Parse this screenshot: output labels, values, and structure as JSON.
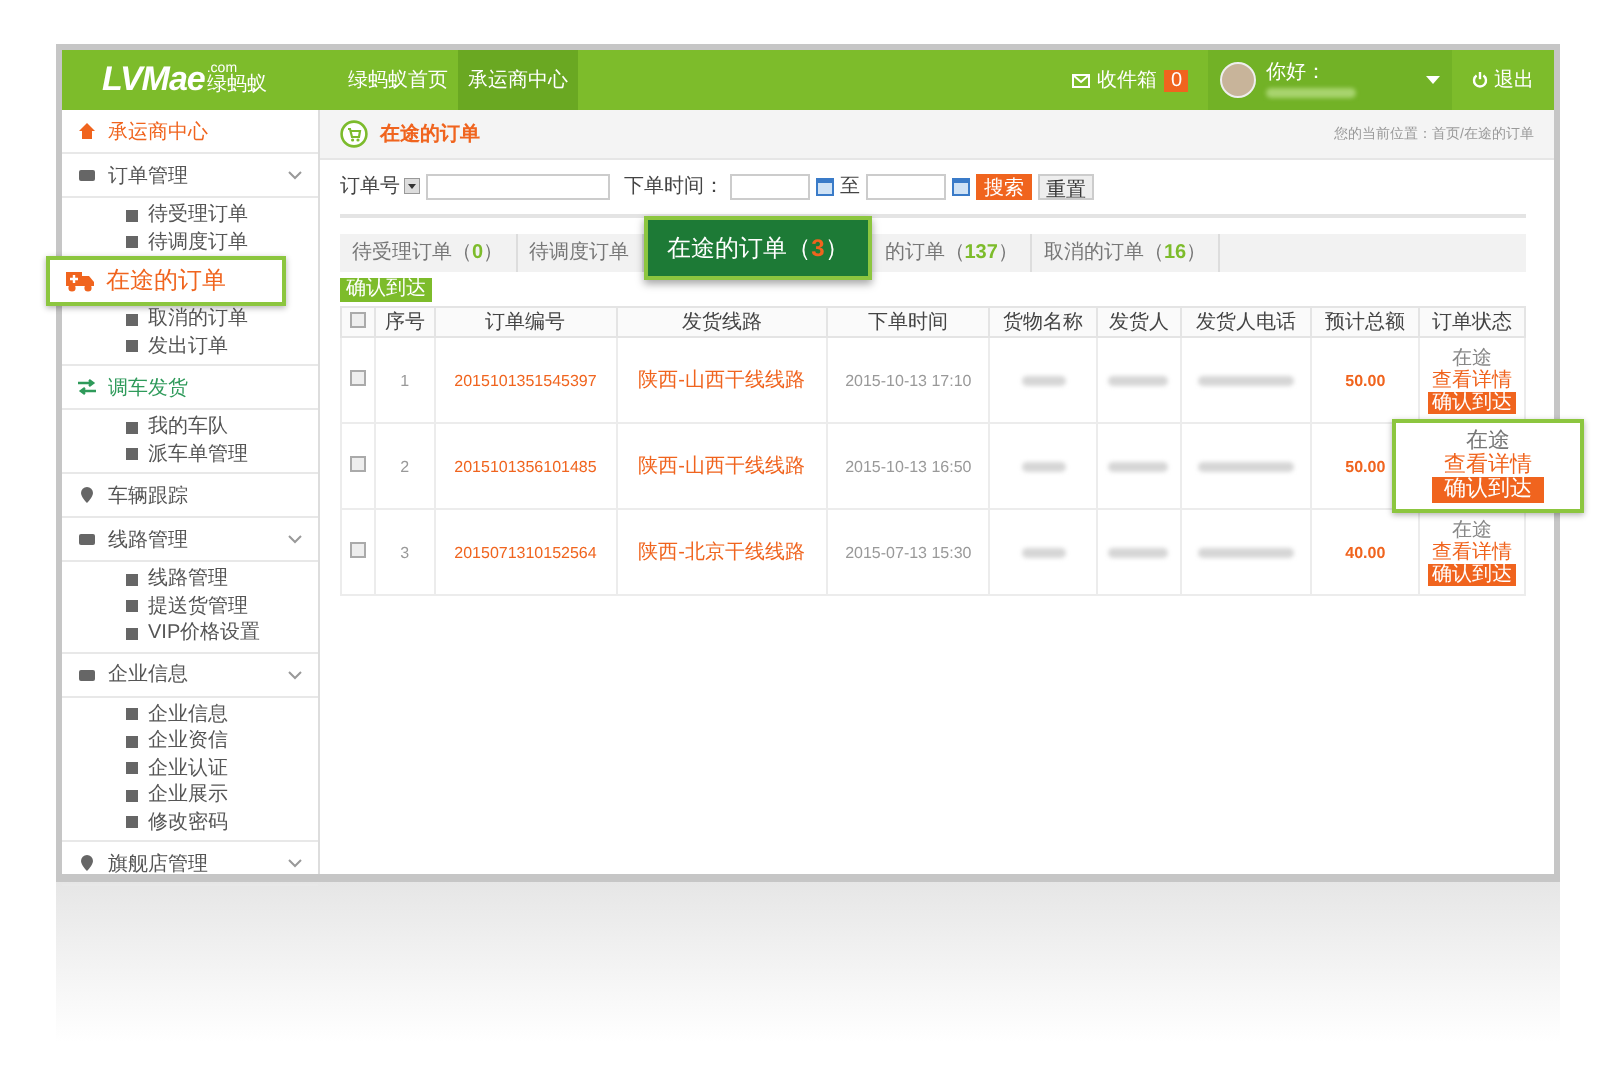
{
  "header": {
    "logo": "LVMae",
    "logo_sub": ".com",
    "logo_cn": "绿蚂蚁",
    "nav": [
      {
        "label": "绿蚂蚁首页",
        "selected": false
      },
      {
        "label": "承运商中心",
        "selected": true
      }
    ],
    "inbox": {
      "label": "收件箱",
      "count": "0"
    },
    "greeting": "你好：",
    "logout": "退出"
  },
  "sidebar": {
    "items": [
      {
        "label": "承运商中心",
        "color": "#f0641e",
        "has_submenu": false
      },
      {
        "label": "订单管理",
        "color": "#555555",
        "has_submenu": true,
        "children": [
          {
            "kind": "item",
            "label": "待受理订单"
          },
          {
            "kind": "item",
            "label": "待调度订单"
          },
          {
            "kind": "callout",
            "label": "在途的订单"
          },
          {
            "kind": "item",
            "label": "取消的订单"
          },
          {
            "kind": "item",
            "label": "发出订单"
          }
        ]
      },
      {
        "label": "调车发货",
        "color": "#2e9a5a",
        "has_submenu": false,
        "children": [
          {
            "kind": "item",
            "label": "我的车队"
          },
          {
            "kind": "item",
            "label": "派车单管理"
          }
        ]
      },
      {
        "label": "车辆跟踪",
        "color": "#555555",
        "has_submenu": false
      },
      {
        "label": "线路管理",
        "color": "#555555",
        "has_submenu": true,
        "children": [
          {
            "kind": "item",
            "label": "线路管理"
          },
          {
            "kind": "item",
            "label": "提送货管理"
          },
          {
            "kind": "item",
            "label": "VIP价格设置"
          }
        ]
      },
      {
        "label": "企业信息",
        "color": "#555555",
        "has_submenu": true,
        "children": [
          {
            "kind": "item",
            "label": "企业信息"
          },
          {
            "kind": "item",
            "label": "企业资信"
          },
          {
            "kind": "item",
            "label": "企业认证"
          },
          {
            "kind": "item",
            "label": "企业展示"
          },
          {
            "kind": "item",
            "label": "修改密码"
          }
        ]
      },
      {
        "label": "旗舰店管理",
        "color": "#555555",
        "has_submenu": true
      }
    ]
  },
  "page": {
    "title": "在途的订单",
    "breadcrumb": "您的当前位置：首页/在途的订单"
  },
  "search": {
    "select": "订单号",
    "time_label": "下单时间：",
    "to": "至",
    "search_button": "搜索",
    "reset_button": "重置"
  },
  "count_brackets": [
    "（",
    "）"
  ],
  "tabs": [
    {
      "label": "待受理订单",
      "count": "0",
      "selected": false
    },
    {
      "label": "待调度订单",
      "selected": false
    },
    {
      "label": "在途的订单",
      "count": "3",
      "selected": true
    },
    {
      "label": "的订单",
      "count": "137",
      "selected": false
    },
    {
      "label": "取消的订单",
      "count": "16",
      "selected": false
    }
  ],
  "confirm_button": "确认到达",
  "table": {
    "select_all": false,
    "columns": [
      "序号",
      "订单编号",
      "发货线路",
      "下单时间",
      "货物名称",
      "发货人",
      "发货人电话",
      "预计总额",
      "订单状态"
    ],
    "rows": [
      {
        "selected": false,
        "index": "1",
        "order_no": "2015101351545397",
        "route": "陕西-山西干线线路",
        "time": "2015-10-13 17:10",
        "amount": "50.00",
        "status": "在途",
        "details": "查看详情",
        "action": "确认到达",
        "callout": false
      },
      {
        "selected": false,
        "index": "2",
        "order_no": "2015101356101485",
        "route": "陕西-山西干线线路",
        "time": "2015-10-13 16:50",
        "amount": "50.00",
        "status": "在途",
        "details": "查看详情",
        "action": "确认到达",
        "callout": true
      },
      {
        "selected": false,
        "index": "3",
        "order_no": "2015071310152564",
        "route": "陕西-北京干线线路",
        "time": "2015-07-13 15:30",
        "amount": "40.00",
        "status": "在途",
        "details": "查看详情",
        "action": "确认到达",
        "callout": false
      }
    ]
  }
}
